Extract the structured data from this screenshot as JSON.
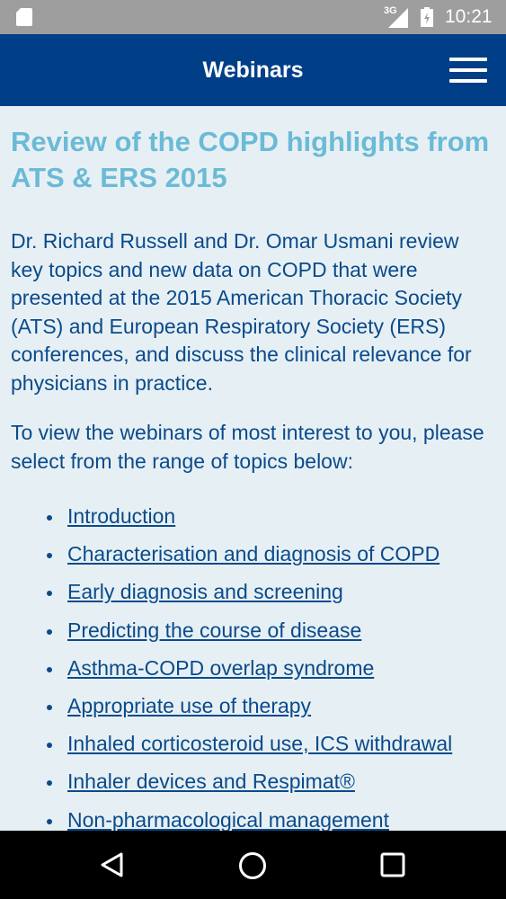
{
  "status_bar": {
    "network": "3G",
    "time": "10:21",
    "icons": [
      "sd-card-icon",
      "signal-icon",
      "battery-icon"
    ]
  },
  "app_bar": {
    "title": "Webinars",
    "menu_icon": "hamburger-menu-icon"
  },
  "content": {
    "title": "Review of the COPD highlights from ATS & ERS 2015",
    "intro": "Dr. Richard Russell and Dr. Omar Usmani review key topics and new data on COPD that were presented at the 2015 American Thoracic Society (ATS) and European Respiratory Society (ERS) conferences, and discuss the clinical relevance for physicians in practice.",
    "prompt": "To view the webinars of most interest to you, please select from the range of topics below:",
    "topics": [
      "Introduction",
      "Characterisation and diagnosis of COPD",
      "Early diagnosis and screening",
      "Predicting the course of disease",
      "Asthma-COPD overlap syndrome",
      "Appropriate use of therapy",
      "Inhaled corticosteroid use, ICS withdrawal",
      "Inhaler devices and Respimat®",
      "Non-pharmacological management"
    ]
  },
  "nav_bar": {
    "icons": [
      "back-icon",
      "home-icon",
      "recent-apps-icon"
    ]
  },
  "colors": {
    "app_bar": "#003f87",
    "title": "#6bbad6",
    "text": "#0b4a8b",
    "background": "#e6f0f4",
    "status_bar": "#9e9e9e"
  }
}
